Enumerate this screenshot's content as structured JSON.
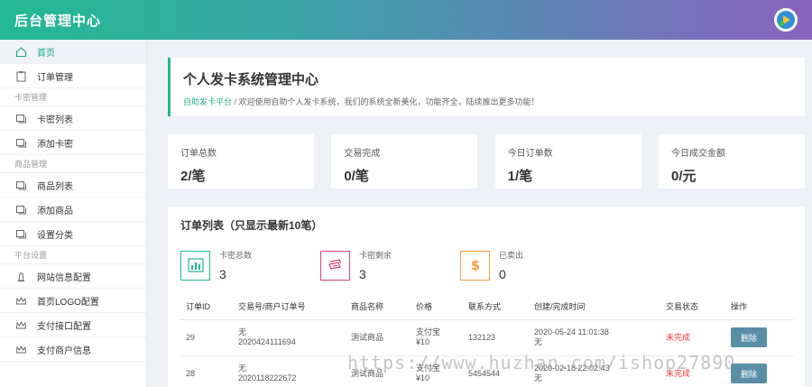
{
  "topbar": {
    "title": "后台管理中心",
    "avatar_icon": "app-logo-icon"
  },
  "sidebar": {
    "items": [
      {
        "label": "首页",
        "icon": "home-icon",
        "active": true
      },
      {
        "label": "订单管理",
        "icon": "clipboard-icon"
      },
      {
        "section": "卡密管理"
      },
      {
        "label": "卡密列表",
        "icon": "card-list-icon"
      },
      {
        "label": "添加卡密",
        "icon": "card-add-icon"
      },
      {
        "section": "商品管理"
      },
      {
        "label": "商品列表",
        "icon": "product-list-icon"
      },
      {
        "label": "添加商品",
        "icon": "product-add-icon"
      },
      {
        "label": "设置分类",
        "icon": "category-icon"
      },
      {
        "section": "平台设置"
      },
      {
        "label": "网站信息配置",
        "icon": "bell-icon"
      },
      {
        "label": "首页LOGO配置",
        "icon": "crown-icon"
      },
      {
        "label": "支付接口配置",
        "icon": "crown-icon"
      },
      {
        "label": "支付商户信息",
        "icon": "crown-icon"
      }
    ]
  },
  "welcome": {
    "title": "个人发卡系统管理中心",
    "link": "自助发卡平台",
    "separator": " / ",
    "message": "欢迎使用自助个人发卡系统，我们的系统全新美化，功能齐全，陆续推出更多功能！"
  },
  "stats": [
    {
      "label": "订单总数",
      "value": "2/笔"
    },
    {
      "label": "交易完成",
      "value": "0/笔"
    },
    {
      "label": "今日订单数",
      "value": "1/笔"
    },
    {
      "label": "今日成交金额",
      "value": "0/元"
    }
  ],
  "orders": {
    "title": "订单列表（只显示最新10笔）",
    "counters": [
      {
        "label": "卡密总数",
        "value": "3",
        "icon": "bar-chart-icon",
        "color": "#22b994"
      },
      {
        "label": "卡密剩余",
        "value": "3",
        "icon": "card-icon",
        "color": "#d9427a"
      },
      {
        "label": "已卖出",
        "value": "0",
        "icon": "dollar-icon",
        "color": "#f0a040"
      }
    ],
    "columns": [
      "订单ID",
      "交易号/商户订单号",
      "商品名称",
      "价格",
      "联系方式",
      "创建/完成时间",
      "交易状态",
      "操作"
    ],
    "rows": [
      {
        "id": "29",
        "trade_no": "无",
        "merchant_no": "2020424111694",
        "product": "测试商品",
        "pay": "支付宝",
        "price": "¥10",
        "contact": "132123",
        "created": "2020-05-24 11:01:38",
        "finished": "无",
        "status": "未完成",
        "action": "删除"
      },
      {
        "id": "28",
        "trade_no": "无",
        "merchant_no": "2020118222672",
        "product": "测试商品",
        "pay": "支付宝",
        "price": "¥10",
        "contact": "5454544",
        "created": "2020-02-18 22:02:43",
        "finished": "无",
        "status": "未完成",
        "action": "删除"
      }
    ]
  },
  "watermark": "https://www.huzhan.com/ishop27890"
}
